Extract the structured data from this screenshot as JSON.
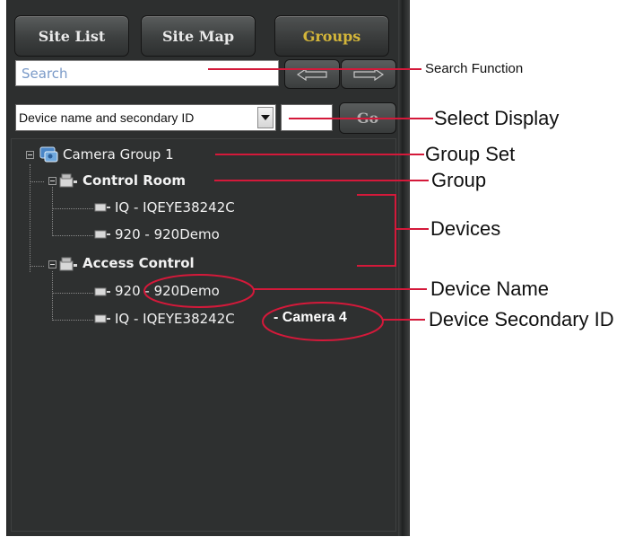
{
  "tabs": [
    {
      "label": "Site List"
    },
    {
      "label": "Site Map"
    },
    {
      "label": "Groups"
    }
  ],
  "search": {
    "placeholder": "Search"
  },
  "nav": {
    "back_icon": "arrow-left-icon",
    "forward_icon": "arrow-right-icon"
  },
  "display_select": {
    "value": "Device name and secondary ID"
  },
  "go_button": {
    "label": "Go"
  },
  "tree": {
    "group_set": {
      "label": "Camera Group 1"
    },
    "groups": [
      {
        "label": "Control Room",
        "devices": [
          {
            "label": "IQ - IQEYE38242C"
          },
          {
            "label": "920 - 920Demo"
          }
        ]
      },
      {
        "label": "Access Control",
        "devices": [
          {
            "label": "920 - 920Demo"
          },
          {
            "label": "IQ - IQEYE38242C"
          }
        ]
      }
    ],
    "secondary_id": "- Camera 4"
  },
  "annotations": {
    "search_function": "Search Function",
    "select_display": "Select Display",
    "group_set": "Group Set",
    "group": "Group",
    "devices": "Devices",
    "device_name": "Device Name",
    "device_secondary_id": "Device Secondary ID"
  },
  "colors": {
    "annotation_line": "#d4193a",
    "active_tab": "#d4b63a",
    "panel_bg": "#2d2f2f"
  }
}
